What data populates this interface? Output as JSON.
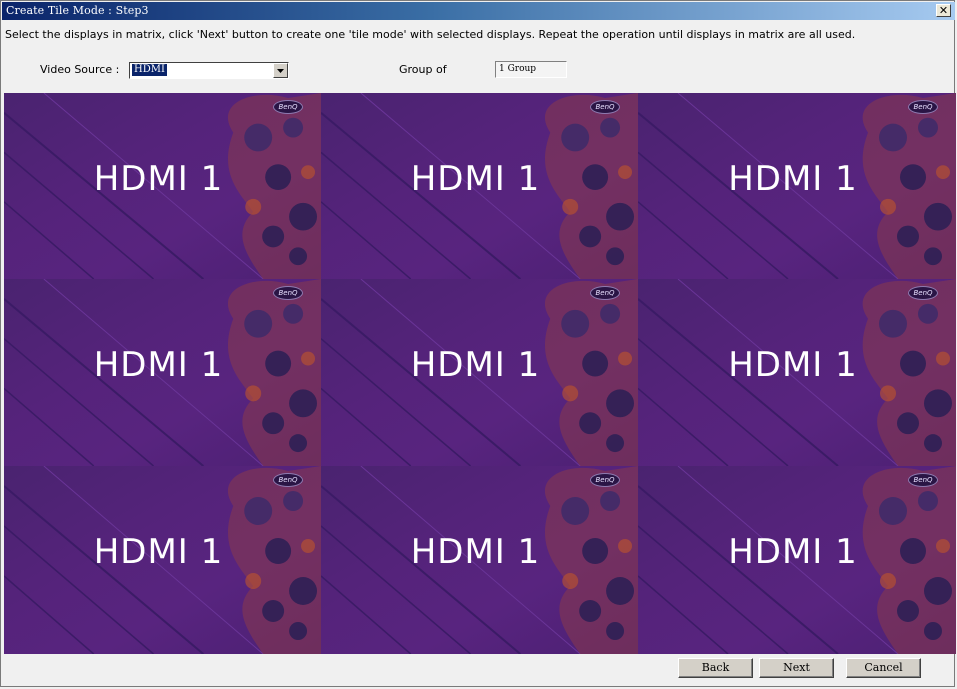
{
  "window": {
    "title": "Create Tile Mode : Step3",
    "close_glyph": "✕"
  },
  "instruction": "Select the displays in matrix, click 'Next' button to create one 'tile mode' with selected displays. Repeat the operation until displays in matrix are all used.",
  "video_source": {
    "label": "Video Source :",
    "selected": "HDMI"
  },
  "group": {
    "label": "Group of",
    "value": "1 Group"
  },
  "matrix": {
    "rows": 3,
    "cols": 3,
    "tiles": [
      {
        "text": "HDMI 1",
        "logo": "BenQ"
      },
      {
        "text": "HDMI 1",
        "logo": "BenQ"
      },
      {
        "text": "HDMI 1",
        "logo": "BenQ"
      },
      {
        "text": "HDMI 1",
        "logo": "BenQ"
      },
      {
        "text": "HDMI 1",
        "logo": "BenQ"
      },
      {
        "text": "HDMI 1",
        "logo": "BenQ"
      },
      {
        "text": "HDMI 1",
        "logo": "BenQ"
      },
      {
        "text": "HDMI 1",
        "logo": "BenQ"
      },
      {
        "text": "HDMI 1",
        "logo": "BenQ"
      }
    ]
  },
  "buttons": {
    "back": "Back",
    "next": "Next",
    "cancel": "Cancel"
  },
  "colors": {
    "titlebar_start": "#0a246a",
    "tile_purple": "#55237b",
    "pattern_orange": "#c0552a"
  }
}
